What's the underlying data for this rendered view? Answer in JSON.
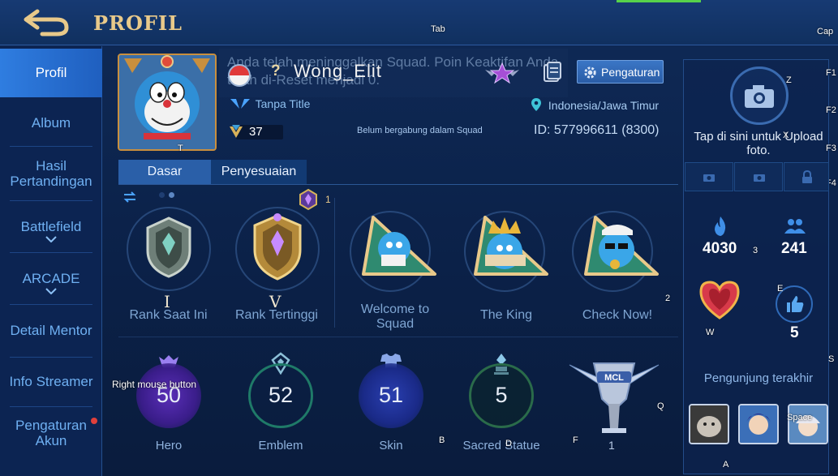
{
  "header": {
    "title": "PROFIL",
    "back_icon": "back-arrow-icon"
  },
  "key_hints": {
    "tab": "Tab",
    "cap": "Cap",
    "f1": "F1",
    "f2": "F2",
    "f3": "F3",
    "f4": "F4",
    "z": "Z",
    "x": "X",
    "t": "T",
    "e": "E",
    "w": "W",
    "s": "S",
    "q": "Q",
    "b": "B",
    "d": "D",
    "f": "F",
    "a": "A",
    "n2": "2",
    "n3": "3",
    "space": "Space",
    "rmb": "Right mouse button"
  },
  "sidebar": {
    "items": [
      {
        "label": "Profil",
        "active": true
      },
      {
        "label": "Album"
      },
      {
        "label": "Hasil Pertandingan"
      },
      {
        "label": "Battlefield"
      },
      {
        "label": "ARCADE"
      },
      {
        "label": "Detail Mentor"
      },
      {
        "label": "Info Streamer"
      },
      {
        "label": "Pengaturan Akun"
      }
    ]
  },
  "profile": {
    "toast": "Anda telah meninggalkan Squad. Poin Keaktifan Anda telah di-Reset menjadi 0.",
    "name_prefix": "?",
    "username": "Wong_Elit",
    "settings_label": "Pengaturan",
    "title": "Tanpa Title",
    "location": "Indonesia/Jawa Timur",
    "level": "37",
    "squad_status": "Belum bergabung dalam Squad",
    "id": "ID: 577996611 (8300)"
  },
  "tabs": [
    "Dasar",
    "Penyesuaian"
  ],
  "ranks": {
    "current_numeral": "I",
    "highest_numeral": "V",
    "current_label": "Rank Saat Ini",
    "highest_label": "Rank Tertinggi",
    "season_count": "1"
  },
  "achievements": [
    {
      "label": "Welcome to Squad"
    },
    {
      "label": "The King"
    },
    {
      "label": "Check Now!"
    }
  ],
  "stats": [
    {
      "label": "Hero",
      "value": "50",
      "color": "#6a3fc9"
    },
    {
      "label": "Emblem",
      "value": "52",
      "color": "#2f8f7a"
    },
    {
      "label": "Skin",
      "value": "51",
      "color": "#3a52c9"
    },
    {
      "label": "Sacred Statue",
      "value": "5",
      "color": "#3fa068"
    }
  ],
  "mcl": {
    "count": "1"
  },
  "right_panel": {
    "upload_text": "Tap di sini untuk Upload foto.",
    "popularity": "4030",
    "followers": "241",
    "likes": "5",
    "visitors_label": "Pengunjung terakhir"
  },
  "colors": {
    "accent_gold": "#e8c98a",
    "active_tab": "#2f7de0",
    "link_blue": "#6fb0f2"
  }
}
